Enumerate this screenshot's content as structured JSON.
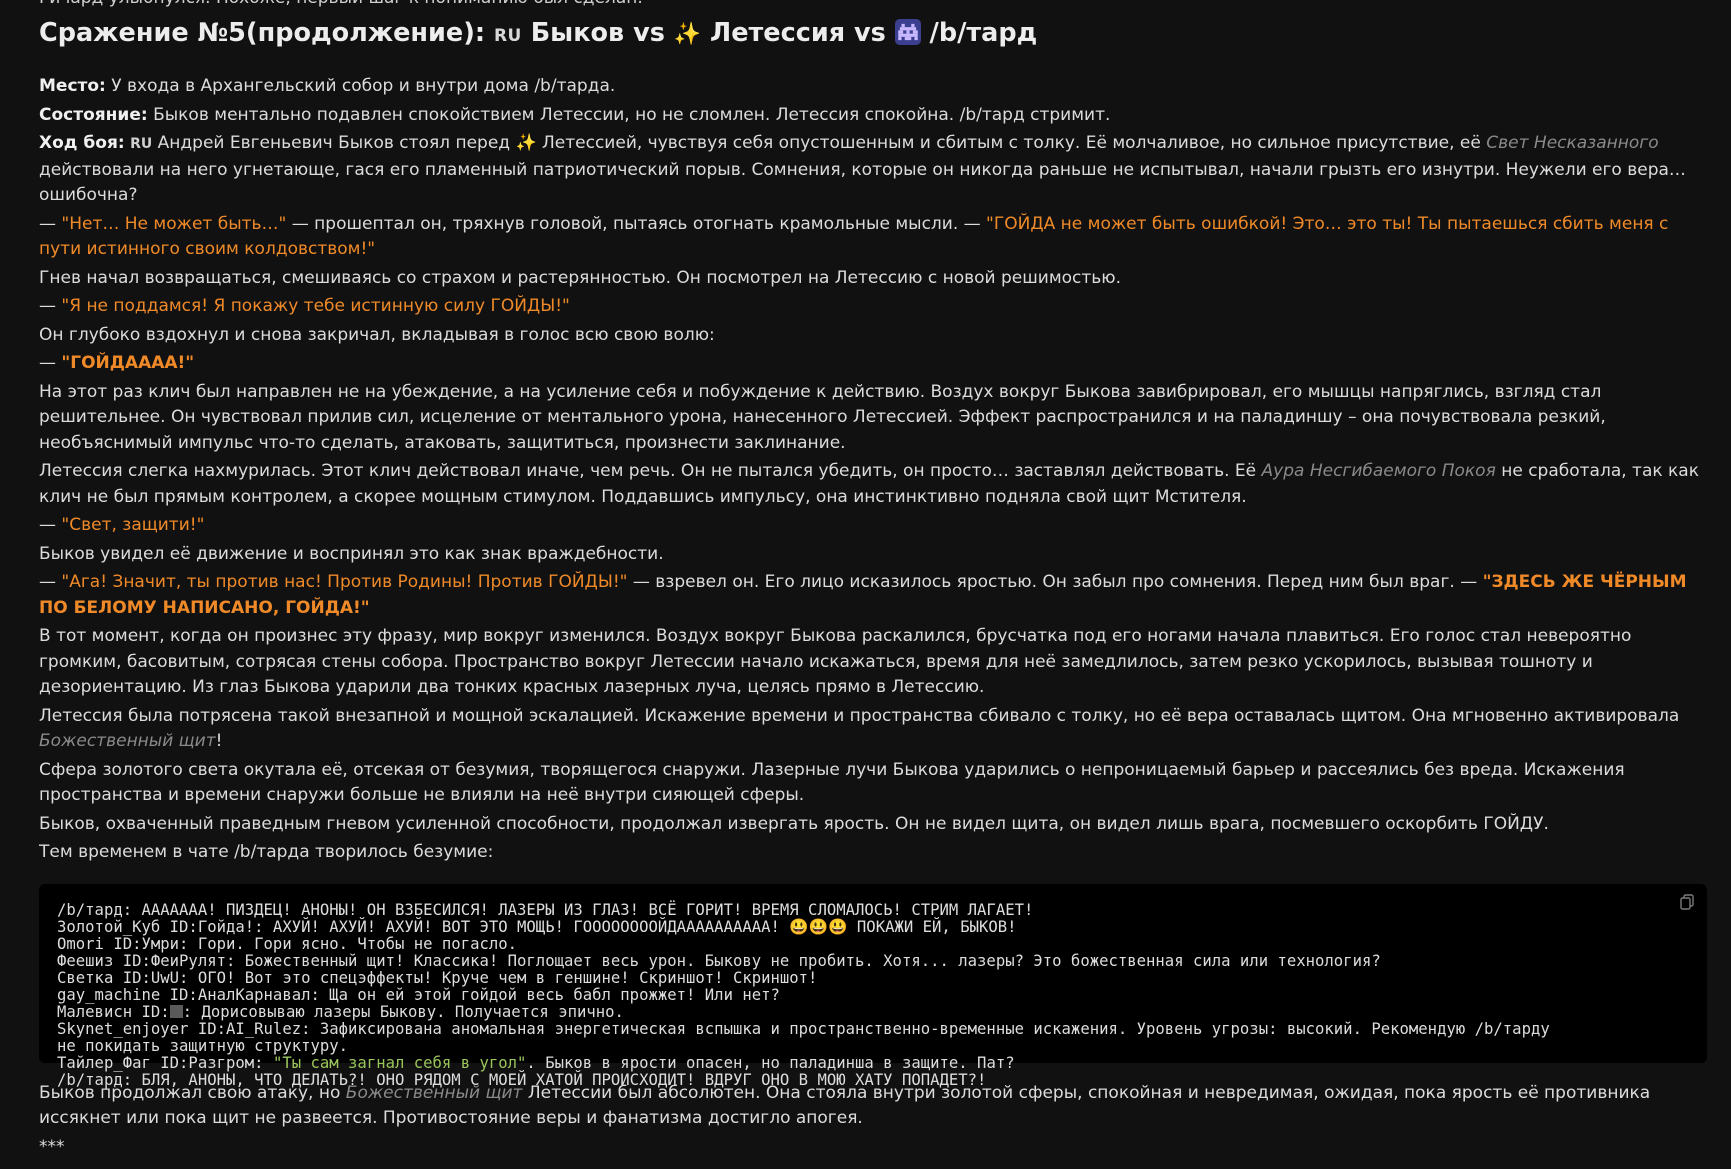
{
  "top_cut": "Ричард улыбнулся. Похоже, первый шаг к пониманию был сделан.",
  "heading": {
    "prefix": "Сражение №5(продолжение): ",
    "flag": "RU",
    "name1": " Быков vs ",
    "sparkle": "✨",
    "name2": " Летессия vs ",
    "alien_icon": "alien-monster-icon",
    "name3": " /b/тард"
  },
  "place": {
    "label": "Место:",
    "text": " У входа в Архангельский собор и внутри дома /b/тарда."
  },
  "state": {
    "label": "Состояние:",
    "text": " Быков ментально подавлен спокойствием Летессии, но не сломлен. Летессия спокойна. /b/тард стримит."
  },
  "battle": {
    "label": "Ход боя:",
    "flag": "RU",
    "t1": " Андрей Евгеньевич Быков стоял перед ",
    "sparkle": "✨",
    "t2": " Летессией, чувствуя себя опустошенным и сбитым с толку. Её молчаливое, но сильное присутствие, её ",
    "i1": "Свет Несказанного",
    "t3": " действовали на него угнетающе, гася его пламенный патриотический порыв. Сомнения, которые он никогда раньше не испытывал, начали грызть его изнутри. Неужели его вера… ошибочна?"
  },
  "p2": {
    "dash": "— ",
    "q1": "\"Нет… Не может быть…\"",
    "t1": " — прошептал он, тряхнув головой, пытаясь отогнать крамольные мысли. — ",
    "q2": "\"ГОЙДА не может быть ошибкой! Это… это ты! Ты пытаешься сбить меня с пути истинного своим колдовством!\""
  },
  "p3": "Гнев начал возвращаться, смешиваясь со страхом и растерянностью. Он посмотрел на Летессию с новой решимостью.",
  "p4": {
    "dash": "— ",
    "q": "\"Я не поддамся! Я покажу тебе истинную силу ГОЙДЫ!\""
  },
  "p5": "Он глубоко вздохнул и снова закричал, вкладывая в голос всю свою волю:",
  "p6": {
    "dash": "— ",
    "q": "\"ГОЙДАААА!\""
  },
  "p7": "На этот раз клич был направлен не на убеждение, а на усиление себя и побуждение к действию. Воздух вокруг Быкова завибрировал, его мышцы напряглись, взгляд стал решительнее. Он чувствовал прилив сил, исцеление от ментального урона, нанесенного Летессией. Эффект распространился и на паладиншу – она почувствовала резкий, необъяснимый импульс что-то сделать, атаковать, защититься, произнести заклинание.",
  "p8": {
    "t1": "Летессия слегка нахмурилась. Этот клич действовал иначе, чем речь. Он не пытался убедить, он просто… заставлял действовать. Её ",
    "i1": "Аура Несгибаемого Покоя",
    "t2": " не сработала, так как клич не был прямым контролем, а скорее мощным стимулом. Поддавшись импульсу, она инстинктивно подняла свой щит Мстителя."
  },
  "p9": {
    "dash": "— ",
    "q": "\"Свет, защити!\""
  },
  "p10": "Быков увидел её движение и воспринял это как знак враждебности.",
  "p11": {
    "dash": "— ",
    "q1": "\"Ага! Значит, ты против нас! Против Родины! Против ГОЙДЫ!\"",
    "t1": " — взревел он. Его лицо исказилось яростью. Он забыл про сомнения. Перед ним был враг. — ",
    "q2": "\"ЗДЕСЬ ЖЕ ЧЁРНЫМ ПО БЕЛОМУ НАПИСАНО, ГОЙДА!\""
  },
  "p12": "В тот момент, когда он произнес эту фразу, мир вокруг изменился. Воздух вокруг Быкова раскалился, брусчатка под его ногами начала плавиться. Его голос стал невероятно громким, басовитым, сотрясая стены собора. Пространство вокруг Летессии начало искажаться, время для неё замедлилось, затем резко ускорилось, вызывая тошноту и дезориентацию. Из глаз Быкова ударили два тонких красных лазерных луча, целясь прямо в Летессию.",
  "p13": {
    "t1": "Летессия была потрясена такой внезапной и мощной эскалацией. Искажение времени и пространства сбивало с толку, но её вера оставалась щитом. Она мгновенно активировала ",
    "i1": "Божественный щит",
    "t2": "!"
  },
  "p14": "Сфера золотого света окутала её, отсекая от безумия, творящегося снаружи. Лазерные лучи Быкова ударились о непроницаемый барьер и рассеялись без вреда. Искажения пространства и времени снаружи больше не влияли на неё внутри сияющей сферы.",
  "p15": "Быков, охваченный праведным гневом усиленной способности, продолжал извергать ярость. Он не видел щита, он видел лишь врага, посмевшего оскорбить ГОЙДУ.",
  "p16": "Тем временем в чате /b/тарда творилось безумие:",
  "chat": {
    "l1": "/b/тард: АААААAA! ПИЗДЕЦ! АНОНЫ! ОН ВЗБЕСИЛСЯ! ЛАЗЕРЫ ИЗ ГЛАЗ! ВСЁ ГОРИТ! ВРЕМЯ СЛОМАЛОСЬ! СТРИМ ЛАГАЕТ!",
    "l2": "Золотой_Куб ID:Гойда!: АХУЙ! АХУЙ! АХУЙ! ВОТ ЭТО МОЩЬ! ГООООООООЙДАААААААААА! 😃😃😃 ПОКАЖИ ЕЙ, БЫКОВ!",
    "l3": "Omori ID:Умри: Гори. Гори ясно. Чтобы не погасло.",
    "l4": "Феешиз ID:ФеиРулят: Божественный щит! Классика! Поглощает весь урон. Быкову не пробить. Хотя... лазеры? Это божественная сила или технология?",
    "l5": "Светка ID:UwU: ОГО! Вот это спецэффекты! Круче чем в геншине! Скриншот! Скриншот!",
    "l6": "gay_machine ID:АналКарнавал: Ща он ей этой гойдой весь бабл прожжет! Или нет?",
    "l7a": "Малевисн ID:",
    "l7b": ": Дорисовываю лазеры Быкову. Получается эпично.",
    "l8": "Skynet_enjoyer ID:AI_Rulez: Зафиксирована аномальная энергетическая вспышка и пространственно-временные искажения. Уровень угрозы: высокий. Рекомендую /b/тарду",
    "l9": "не покидать защитную структуру.",
    "l10a": "Тайлер_Фаг ID:Разгром: ",
    "l10b": "\"Ты сам загнал себя в угол\"",
    "l10c": ". Быков в ярости опасен, но паладинша в защите. Пат?",
    "l11": "/b/тард: БЛЯ, АНОНЫ, ЧТО ДЕЛАТЬ?! ОНО РЯДОМ С МОЕЙ ХАТОЙ ПРОИСХОДИТ! ВДРУГ ОНО В МОЮ ХАТУ ПОПАДЕТ?!",
    "copy_icon": "copy-icon"
  },
  "p17": {
    "t1": "Быков продолжал свою атаку, но ",
    "i1": "Божественный щит",
    "t2": " Летессии был абсолютен. Она стояла внутри золотой сферы, спокойная и невредимая, ожидая, пока ярость её противника иссякнет или пока щит не развеется. Противостояние веры и фанатизма достигло апогея."
  },
  "p18": "***"
}
